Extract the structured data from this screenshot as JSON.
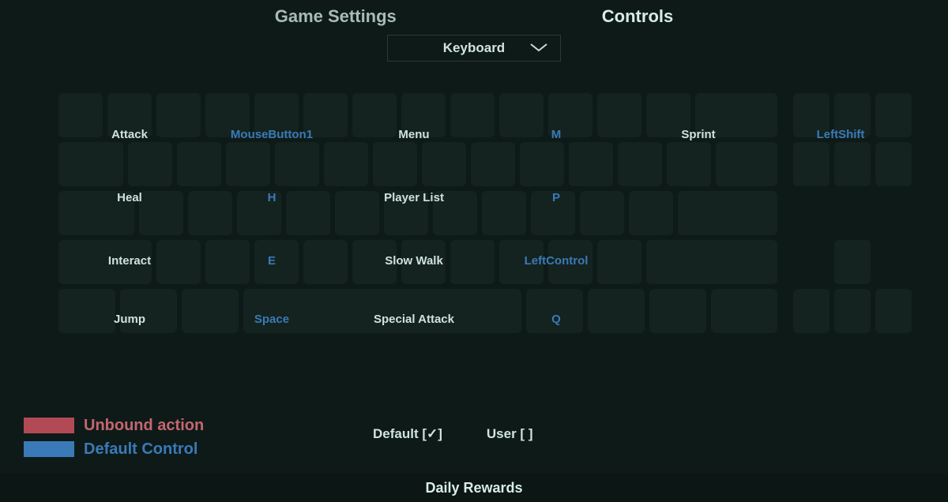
{
  "tabs": {
    "settings": "Game Settings",
    "controls": "Controls"
  },
  "dropdown": {
    "selected": "Keyboard"
  },
  "bindings": [
    {
      "label": "Attack",
      "key": "MouseButton1"
    },
    {
      "label": "Menu",
      "key": "M"
    },
    {
      "label": "Sprint",
      "key": "LeftShift"
    },
    {
      "label": "Heal",
      "key": "H"
    },
    {
      "label": "Player List",
      "key": "P"
    },
    {
      "label": "Interact",
      "key": "E"
    },
    {
      "label": "Slow Walk",
      "key": "LeftControl"
    },
    {
      "label": "Jump",
      "key": "Space"
    },
    {
      "label": "Special Attack",
      "key": "Q"
    }
  ],
  "legend": {
    "unbound": "Unbound action",
    "default": "Default Control"
  },
  "profiles": {
    "default": "Default [✓]",
    "user": "User [ ]"
  },
  "bottom": {
    "daily": "Daily Rewards"
  }
}
